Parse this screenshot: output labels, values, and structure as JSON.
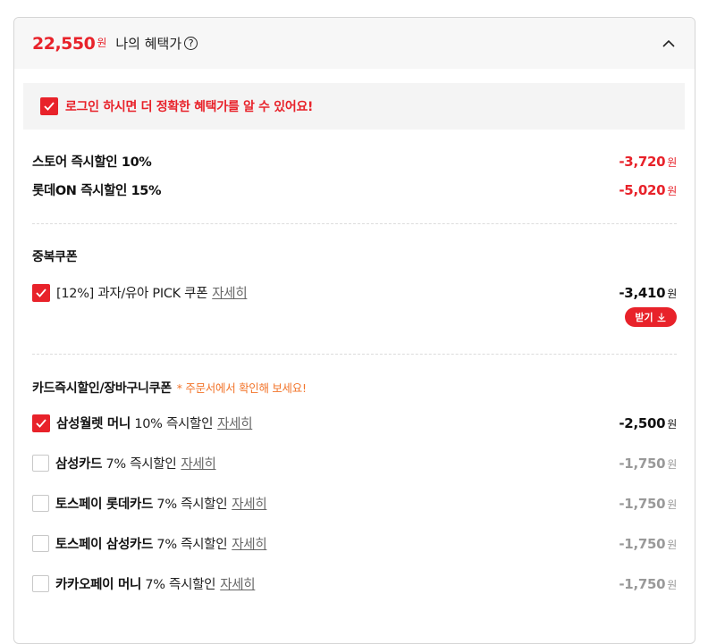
{
  "header": {
    "price": "22,550",
    "won": "원",
    "title": "나의 혜택가"
  },
  "login_notice": "로그인 하시면 더 정확한 혜택가를 알 수 있어요!",
  "instant_discounts": [
    {
      "label": "스토어 즉시할인 10%",
      "amount": "-3,720",
      "won": "원"
    },
    {
      "label": "롯데ON 즉시할인 15%",
      "amount": "-5,020",
      "won": "원"
    }
  ],
  "duplicate_coupon": {
    "title": "중복쿠폰",
    "item": {
      "label": "[12%] 과자/유아 PICK 쿠폰",
      "link": "자세히",
      "amount": "-3,410",
      "won": "원",
      "checked": true
    },
    "receive_button": "받기"
  },
  "card_section": {
    "title": "카드즉시할인/장바구니쿠폰",
    "note": "* 주문서에서 확인해 보세요!",
    "items": [
      {
        "name": "삼성월렛 머니",
        "desc": "10% 즉시할인",
        "link": "자세히",
        "amount": "-2,500",
        "won": "원",
        "checked": true
      },
      {
        "name": "삼성카드",
        "desc": "7% 즉시할인",
        "link": "자세히",
        "amount": "-1,750",
        "won": "원",
        "checked": false
      },
      {
        "name": "토스페이 롯데카드",
        "desc": "7% 즉시할인",
        "link": "자세히",
        "amount": "-1,750",
        "won": "원",
        "checked": false
      },
      {
        "name": "토스페이 삼성카드",
        "desc": "7% 즉시할인",
        "link": "자세히",
        "amount": "-1,750",
        "won": "원",
        "checked": false
      },
      {
        "name": "카카오페이 머니",
        "desc": "7% 즉시할인",
        "link": "자세히",
        "amount": "-1,750",
        "won": "원",
        "checked": false
      }
    ]
  },
  "colors": {
    "accent_red": "#e8222a",
    "note_orange": "#f2742a",
    "disabled_grey": "#999999"
  }
}
